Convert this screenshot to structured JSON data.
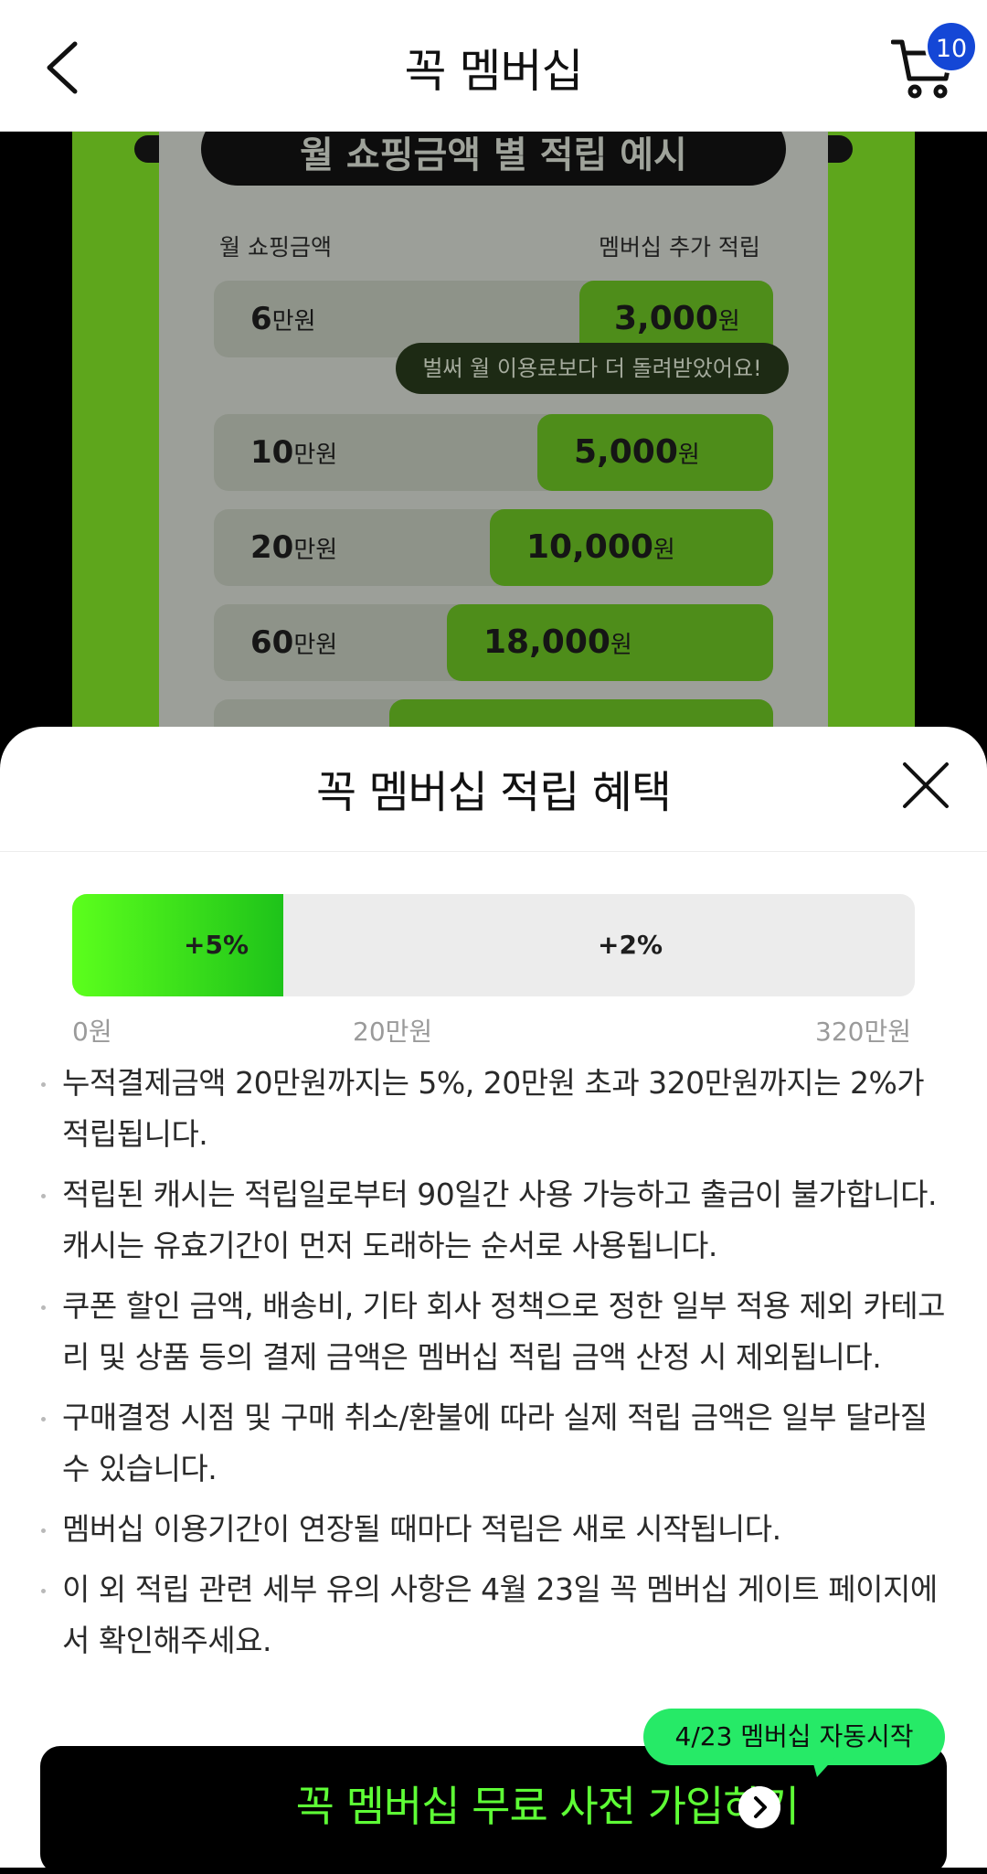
{
  "header": {
    "title": "꼭 멤버십",
    "cart_count": "10"
  },
  "banner": {
    "title": "월 쇼핑금액 별 적립 예시",
    "label_left": "월 쇼핑금액",
    "label_right": "멤버십 추가 적립",
    "tip": "벌써 월 이용료보다 더 돌려받았어요!",
    "rows": [
      {
        "num": "6",
        "unit": "만원",
        "val": "3,000",
        "val_unit": "원"
      },
      {
        "num": "10",
        "unit": "만원",
        "val": "5,000",
        "val_unit": "원"
      },
      {
        "num": "20",
        "unit": "만원",
        "val": "10,000",
        "val_unit": "원"
      },
      {
        "num": "60",
        "unit": "만원",
        "val": "18,000",
        "val_unit": "원"
      }
    ]
  },
  "sheet": {
    "title": "꼭 멤버십 적립 혜택",
    "rate_low": "+5%",
    "rate_high": "+2%",
    "rate_low_share": 0.25,
    "ticks": [
      "0원",
      "20만원",
      "320만원"
    ],
    "notes": [
      "누적결제금액 20만원까지는 5%, 20만원 초과 320만원까지는 2%가 적립됩니다.",
      "적립된 캐시는 적립일로부터 90일간 사용 가능하고 출금이 불가합니다. 캐시는 유효기간이 먼저 도래하는 순서로 사용됩니다.",
      "쿠폰 할인 금액, 배송비, 기타 회사 정책으로 정한 일부 적용 제외 카테고리 및 상품 등의 결제 금액은 멤버십 적립 금액 산정 시 제외됩니다.",
      "구매결정 시점 및 구매 취소/환불에 따라 실제 적립 금액은 일부 달라질 수 있습니다.",
      "멤버십 이용기간이 연장될 때마다 적립은 새로 시작됩니다.",
      "이 외 적립 관련 세부 유의 사항은 4월 23일 꼭 멤버십 게이트 페이지에서 확인해주세요."
    ],
    "tooltip": "4/23 멤버십 자동시작",
    "cta": "꼭 멤버십 무료 사전 가입하기"
  },
  "colors": {
    "accent_green": "#5eff36",
    "badge_blue": "#1447d6",
    "tooltip_green": "#26ea67"
  }
}
